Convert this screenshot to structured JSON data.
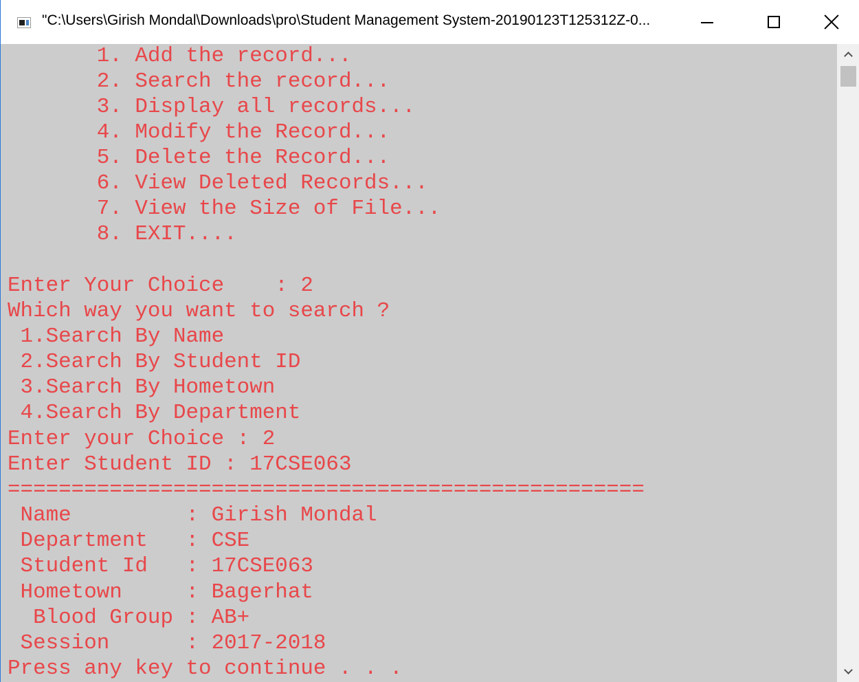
{
  "window": {
    "title": "\"C:\\Users\\Girish Mondal\\Downloads\\pro\\Student Management System-20190123T125312Z-0...",
    "icon": "console-app-icon"
  },
  "caption_buttons": {
    "minimize_icon": "minimize-icon",
    "maximize_icon": "maximize-icon",
    "close_icon": "close-icon"
  },
  "console": {
    "text_color": "#e8474a",
    "background_color": "#cccccc",
    "lines": [
      "       1. Add the record...",
      "       2. Search the record...",
      "       3. Display all records...",
      "       4. Modify the Record...",
      "       5. Delete the Record...",
      "       6. View Deleted Records...",
      "       7. View the Size of File...",
      "       8. EXIT....",
      "",
      "Enter Your Choice    : 2",
      "Which way you want to search ?",
      " 1.Search By Name",
      " 2.Search By Student ID",
      " 3.Search By Hometown",
      " 4.Search By Department",
      "Enter your Choice : 2",
      "Enter Student ID : 17CSE063",
      "==================================================",
      " Name         : Girish Mondal",
      " Department   : CSE",
      " Student Id   : 17CSE063",
      " Hometown     : Bagerhat",
      "  Blood Group : AB+",
      " Session      : 2017-2018",
      "Press any key to continue . . ."
    ]
  },
  "scrollbar": {
    "up_icon": "chevron-up-icon",
    "down_icon": "chevron-down-icon"
  }
}
